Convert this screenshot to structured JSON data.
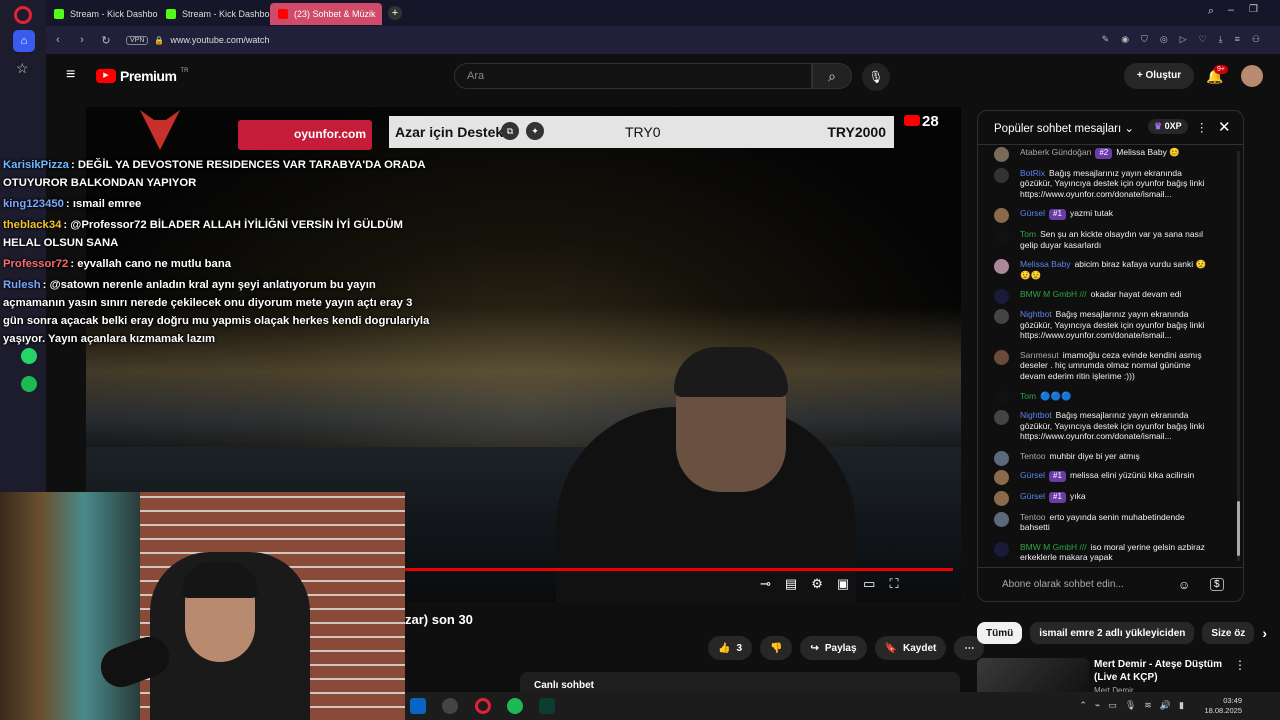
{
  "browser": {
    "tabs": [
      {
        "label": "Stream - Kick Dashboard",
        "active": false
      },
      {
        "label": "Stream - Kick Dashboard",
        "active": false
      },
      {
        "label": "(23) Sohbet & Müzik",
        "active": true
      }
    ],
    "vpn_label": "VPN",
    "url": "www.youtube.com/watch"
  },
  "youtube": {
    "logo_text": "Premium",
    "logo_sup": "TR",
    "search_placeholder": "Ara",
    "create_label": "Oluştur",
    "notif_badge": "9+"
  },
  "video": {
    "donation_text": "Azar için Destek",
    "donation_min": "TRY0",
    "donation_target": "TRY2000",
    "oyunfor_text": "oyunfor.com",
    "viewer_count": "28",
    "title_partial": "zar) son 30"
  },
  "chat_overlay": [
    {
      "user": "KarisikPizza",
      "color": "#6fb8ff",
      "text": ": DEĞİL YA DEVOSTONE RESIDENCES VAR TARABYA'DA ORADA OTUYUROR BALKONDAN YAPIYOR"
    },
    {
      "user": "king123450",
      "color": "#7aa8ff",
      "text": ": ısmail emree"
    },
    {
      "user": "theblack34",
      "color": "#f2c230",
      "text": ": @Professor72 BİLADER ALLAH İYİLİĞNİ VERSİN İYİ GÜLDÜM HELAL OLSUN SANA"
    },
    {
      "user": "Professor72",
      "color": "#ff6b6b",
      "text": ": eyvallah cano ne mutlu bana"
    },
    {
      "user": "Rulesh",
      "color": "#7aa8ff",
      "text": ": @satown nerenle anladın kral aynı şeyi anlatıyorum bu yayın açmamanın yasın sınırı nerede çekilecek onu diyorum mete yayın açtı eray 3 gün sonra açacak belki eray doğru mu yapmis olaçak herkes kendi dogrulariyla yaşıyor. Yayın açanlara kızmamak lazım"
    }
  ],
  "engagement": {
    "likes": "3",
    "share_label": "Paylaş",
    "save_label": "Kaydet",
    "live_chat_label": "Canlı sohbet"
  },
  "chat_panel": {
    "header": "Popüler sohbet mesajları",
    "points": "0XP",
    "input_placeholder": "Abone olarak sohbet edin...",
    "messages": [
      {
        "name": "Ataberk Gündoğan",
        "name_color": "#aaaaaa",
        "badge": "#2",
        "text": "Melissa Baby 😊",
        "av": "#7a6a5a"
      },
      {
        "name": "BotRix",
        "name_color": "#5e84f1",
        "badge": "",
        "text": "Bağış mesajlarınız yayın ekranında gözükür, Yayıncıya destek için oyunfor bağış linki https://www.oyunfor.com/donate/ismail...",
        "av": "#333333"
      },
      {
        "name": "Gürsel",
        "name_color": "#5e84f1",
        "badge": "#1",
        "text": "yazmi tutak",
        "av": "#8a6a4a"
      },
      {
        "name": "Tom",
        "name_color": "#2ba640",
        "badge": "",
        "text": "Sen şu an kickte olsaydın var ya sana nasıl gelip duyar kasarlardı",
        "av": "#111111"
      },
      {
        "name": "Melissa Baby",
        "name_color": "#5e84f1",
        "badge": "",
        "text": "abicim biraz kafaya vurdu sanki 😟😟😟",
        "av": "#aa8899"
      },
      {
        "name": "BMW M GmbH ///",
        "name_color": "#2ba640",
        "badge": "",
        "text": "okadar hayat devam edi",
        "av": "#1a1a3a"
      },
      {
        "name": "Nightbot",
        "name_color": "#5e84f1",
        "badge": "",
        "text": "Bağış mesajlarınız yayın ekranında gözükür, Yayıncıya destek için oyunfor bağış linki https://www.oyunfor.com/donate/ismail...",
        "av": "#444444"
      },
      {
        "name": "Sarımesut",
        "name_color": "#aaaaaa",
        "badge": "",
        "text": "imamoğlu ceza evinde kendini asmış deseler . hiç umrumda olmaz normal günüme devam ederim ritin işlerime :)))",
        "av": "#6a4a3a"
      },
      {
        "name": "Tom",
        "name_color": "#2ba640",
        "badge": "",
        "text": "🔵🔵🔵",
        "av": "#111111"
      },
      {
        "name": "Nightbot",
        "name_color": "#5e84f1",
        "badge": "",
        "text": "Bağış mesajlarınız yayın ekranında gözükür, Yayıncıya destek için oyunfor bağış linki https://www.oyunfor.com/donate/ismail...",
        "av": "#444444"
      },
      {
        "name": "Tentoo",
        "name_color": "#aaaaaa",
        "badge": "",
        "text": "muhbir diye bi yer atmış",
        "av": "#5a6a7a"
      },
      {
        "name": "Gürsel",
        "name_color": "#5e84f1",
        "badge": "#1",
        "text": "melissa elini yüzünü kika acilirsin",
        "av": "#8a6a4a"
      },
      {
        "name": "Gürsel",
        "name_color": "#5e84f1",
        "badge": "#1",
        "text": "yıka",
        "av": "#8a6a4a"
      },
      {
        "name": "Tentoo",
        "name_color": "#aaaaaa",
        "badge": "",
        "text": "erto yayında senin muhabetindende bahsetti",
        "av": "#5a6a7a"
      },
      {
        "name": "BMW M GmbH ///",
        "name_color": "#2ba640",
        "badge": "",
        "text": "iso moral yerine gelsin azbiraz erkeklerle makara yapak",
        "av": "#1a1a3a"
      }
    ]
  },
  "filters": [
    "Tümü",
    "ismail emre 2 adlı yükleyiciden",
    "Size öz"
  ],
  "recommendation": {
    "title": "Mert Demir - Ateşe Düştüm (Live At KÇP)",
    "channel": "Mert Demir"
  },
  "clock": {
    "time": "03:49",
    "date": "18.08.2025"
  }
}
